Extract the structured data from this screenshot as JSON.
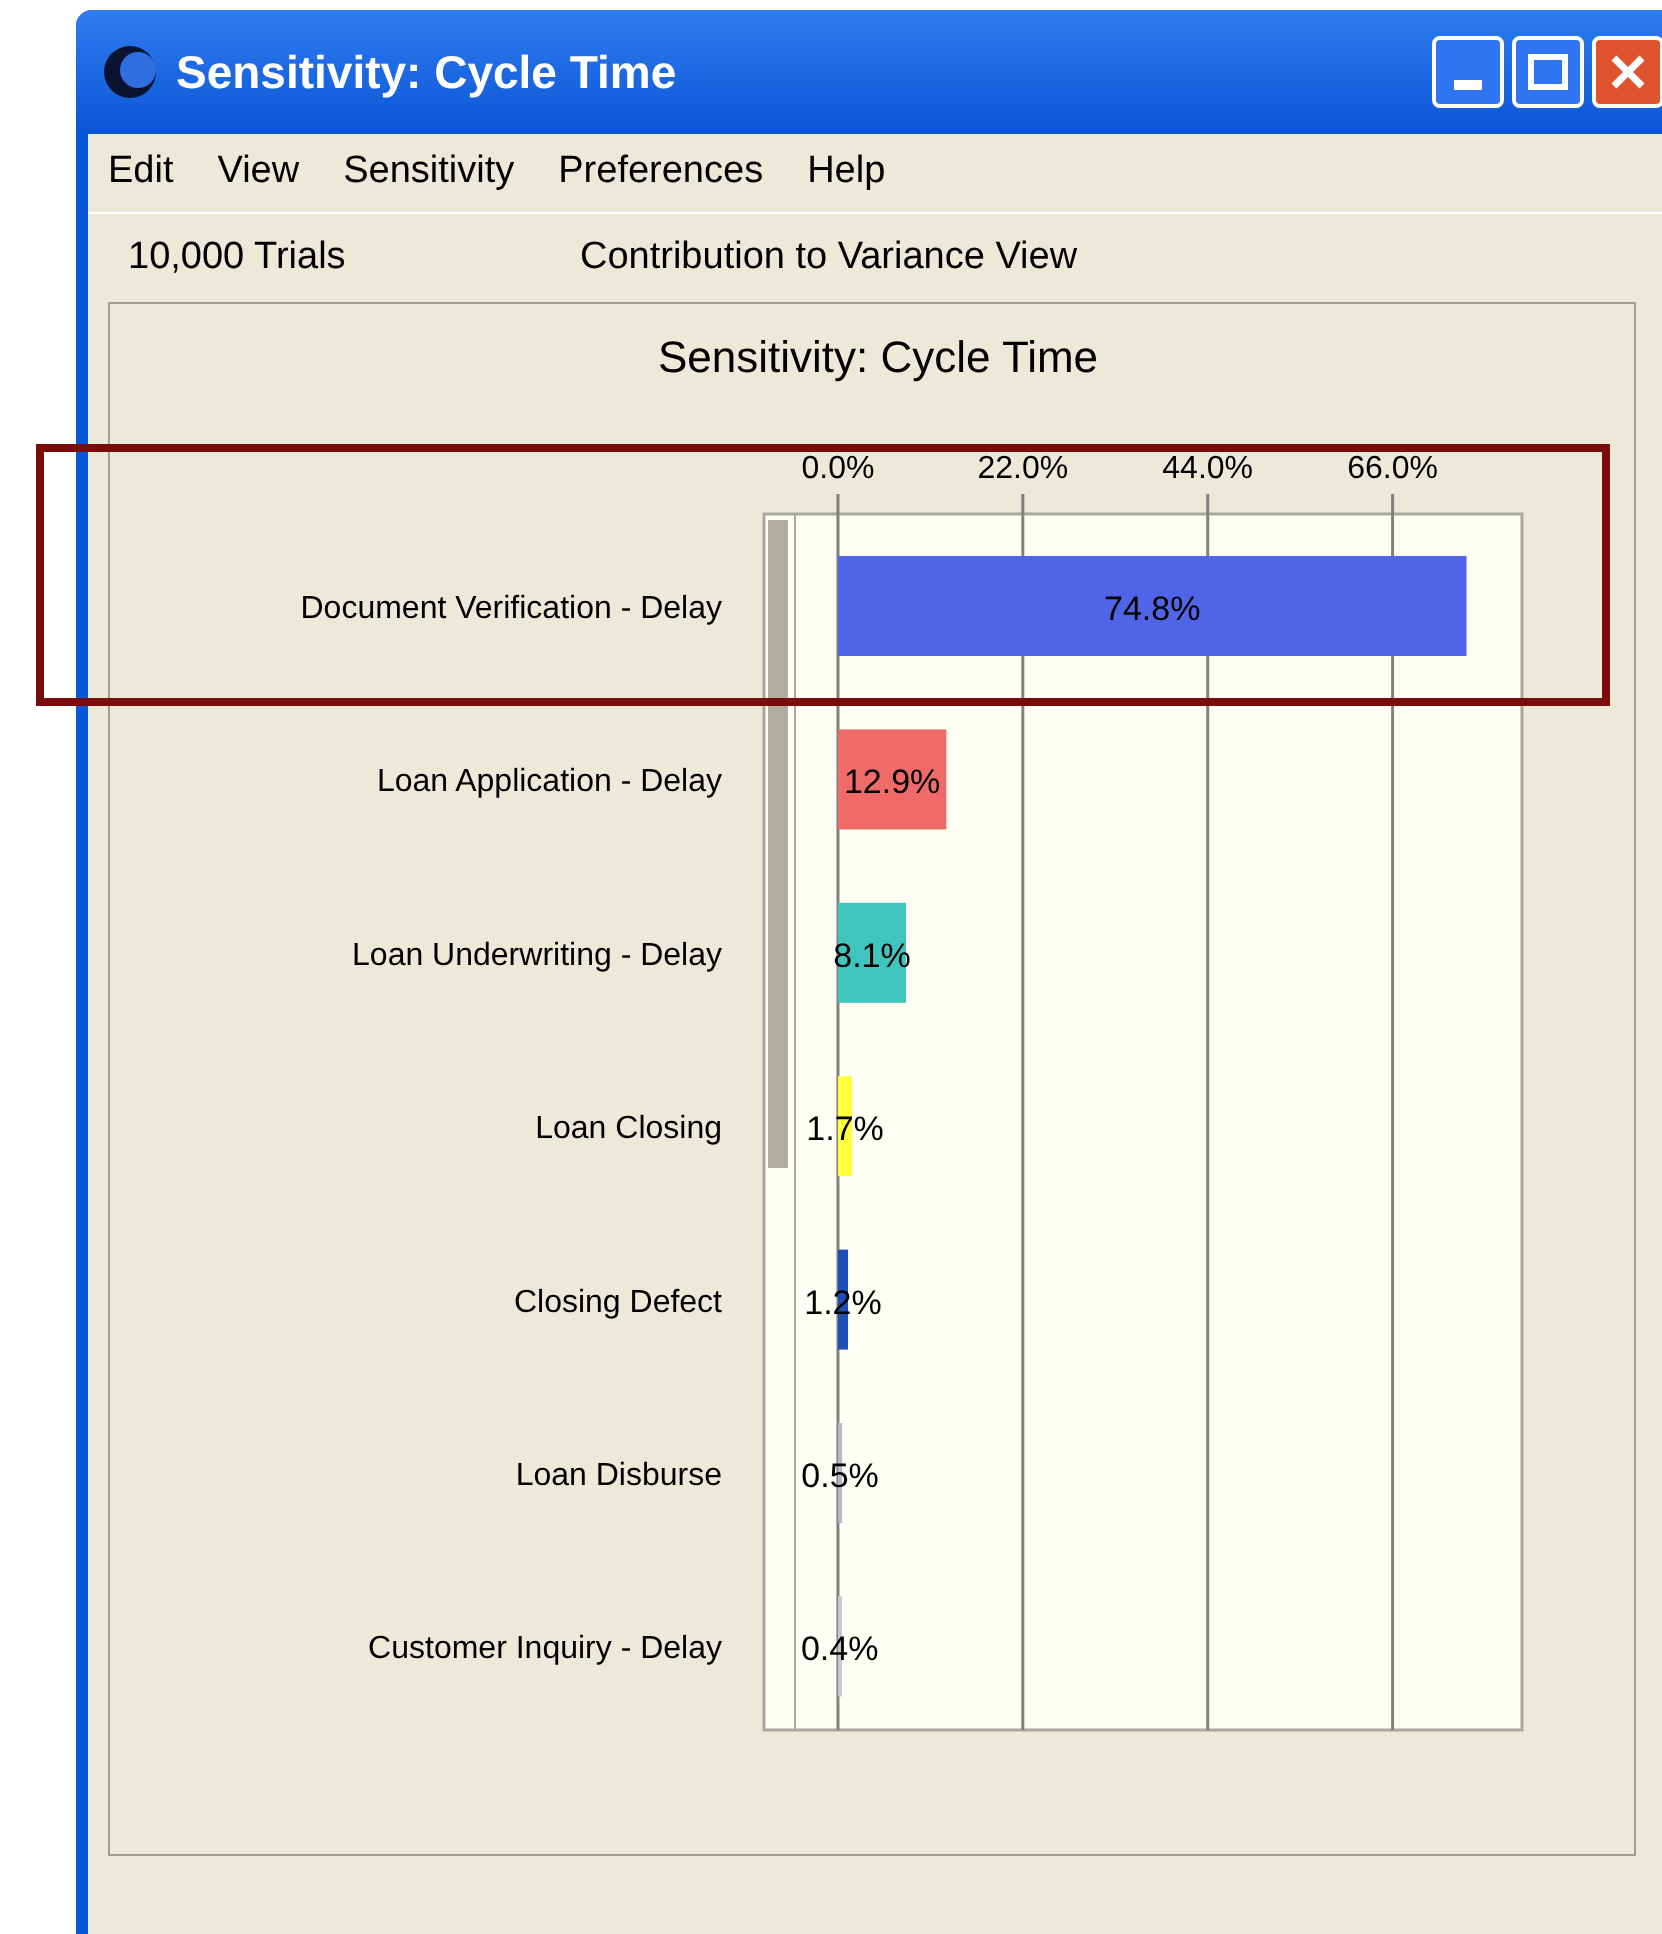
{
  "window": {
    "title": "Sensitivity: Cycle Time"
  },
  "menu": [
    "Edit",
    "View",
    "Sensitivity",
    "Preferences",
    "Help"
  ],
  "info_bar": {
    "trials": "10,000 Trials",
    "view": "Contribution to Variance View"
  },
  "chart": {
    "chart_data": {
      "type": "bar",
      "orientation": "horizontal",
      "stacked": true,
      "grid": true,
      "title": "Sensitivity: Cycle Time",
      "categories": [
        "Document Verification - Delay",
        "Loan Application - Delay",
        "Loan Underwriting - Delay",
        "Loan Closing",
        "Closing Defect",
        "Loan Disburse",
        "Customer Inquiry - Delay"
      ],
      "series": [
        {
          "color": "#5064e8",
          "values": [
            74.8,
            null,
            null,
            null,
            null,
            null,
            null
          ]
        },
        {
          "color": "#f06a6a",
          "values": [
            null,
            12.9,
            null,
            null,
            null,
            null,
            null
          ]
        },
        {
          "color": "#3fc4be",
          "values": [
            null,
            null,
            8.1,
            null,
            null,
            null,
            null
          ]
        },
        {
          "color": "#ffff40",
          "values": [
            null,
            null,
            null,
            1.7,
            null,
            null,
            null
          ]
        },
        {
          "color": "#1f4fb4",
          "values": [
            null,
            null,
            null,
            null,
            1.2,
            null,
            null
          ]
        },
        {
          "color": "#b8b8c0",
          "values": [
            null,
            null,
            null,
            null,
            null,
            0.5,
            null
          ]
        },
        {
          "color": "#c8c8c8",
          "values": [
            null,
            null,
            null,
            null,
            null,
            null,
            0.4
          ]
        }
      ],
      "value_labels": [
        "74.8%",
        "12.9%",
        "8.1%",
        "1.7%",
        "1.2%",
        "0.5%",
        "0.4%"
      ],
      "xlim": [
        -8.8,
        81.4
      ],
      "xticks": [
        {
          "value": 0,
          "label": "0.0%"
        },
        {
          "value": 22,
          "label": "22.0%"
        },
        {
          "value": 44,
          "label": "44.0%"
        },
        {
          "value": 66,
          "label": "66.0%"
        }
      ]
    }
  }
}
